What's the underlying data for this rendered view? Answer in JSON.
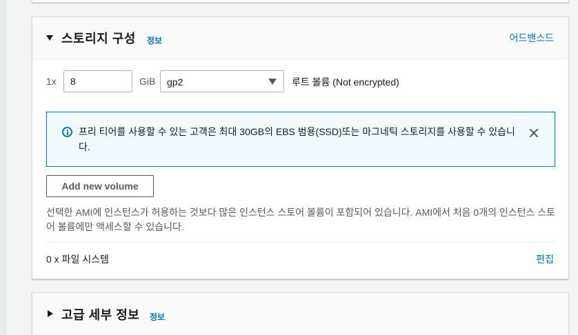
{
  "storage": {
    "title": "스토리지 구성",
    "info_label": "정보",
    "advanced_label": "어드밴스드",
    "volume": {
      "count_label": "1x",
      "size_value": "8",
      "size_unit": "GiB",
      "type_value": "gp2",
      "description": "루트 볼륨  (Not encrypted)"
    },
    "alert": {
      "text": "프리 티어를 사용할 수 있는 고객은 최대 30GB의 EBS 범용(SSD)또는 마그네틱 스토리지를 사용할 수 있습니다."
    },
    "add_volume_label": "Add new volume",
    "ami_note": "선택한 AMI에 인스턴스가 허용하는 것보다 많은 인스턴스 스토어 볼륨이 포함되어 있습니다. AMI에서 처음 0개의 인스턴스 스토어 볼륨에만 액세스할 수 있습니다.",
    "file_systems_label": "0 x 파일 시스템",
    "edit_label": "편집"
  },
  "advanced_details": {
    "title": "고급 세부 정보",
    "info_label": "정보"
  },
  "colors": {
    "link": "#0073bb",
    "alert_background": "#f1faff",
    "page_background": "#f2f3f3"
  },
  "icons": [
    "caret-down-icon",
    "info-circle-icon",
    "close-icon",
    "select-caret-icon",
    "caret-right-icon"
  ]
}
